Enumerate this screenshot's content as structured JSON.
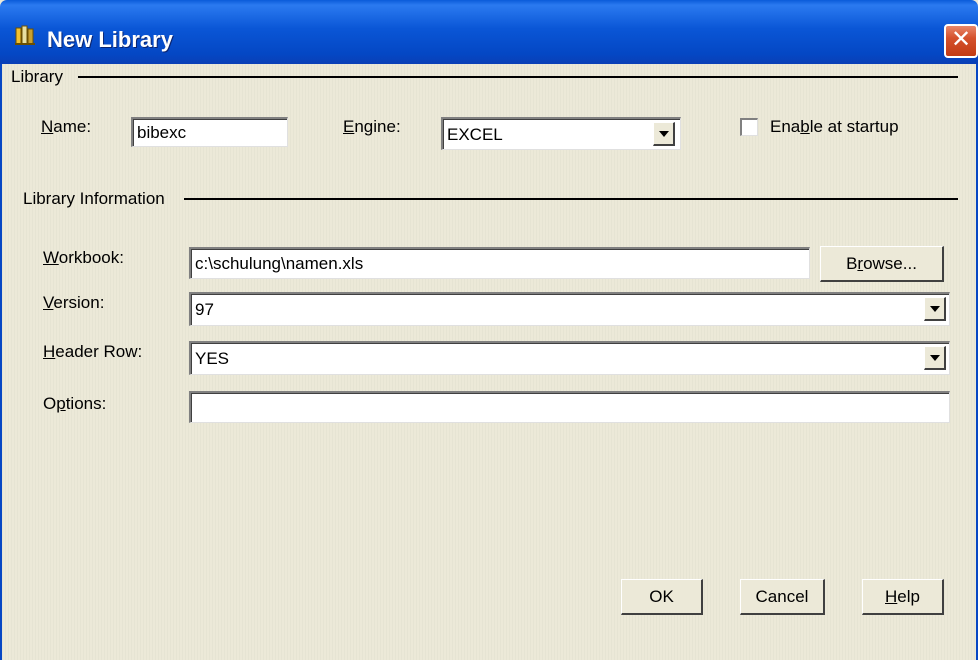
{
  "window": {
    "title": "New Library",
    "close_label": "✕"
  },
  "library_group": {
    "label": "Library",
    "name_label": "Name:",
    "name_value": "bibexc",
    "engine_label": "Engine:",
    "engine_value": "EXCEL",
    "enable_label": "Enable at startup",
    "enable_checked": false
  },
  "info_group": {
    "label": "Library Information",
    "workbook_label": "Workbook:",
    "workbook_value": "c:\\schulung\\namen.xls",
    "browse_label": "Browse...",
    "version_label": "Version:",
    "version_value": "97",
    "header_row_label": "Header Row:",
    "header_row_value": "YES",
    "options_label": "Options:",
    "options_value": ""
  },
  "buttons": {
    "ok": "OK",
    "cancel": "Cancel",
    "help": "Help"
  }
}
